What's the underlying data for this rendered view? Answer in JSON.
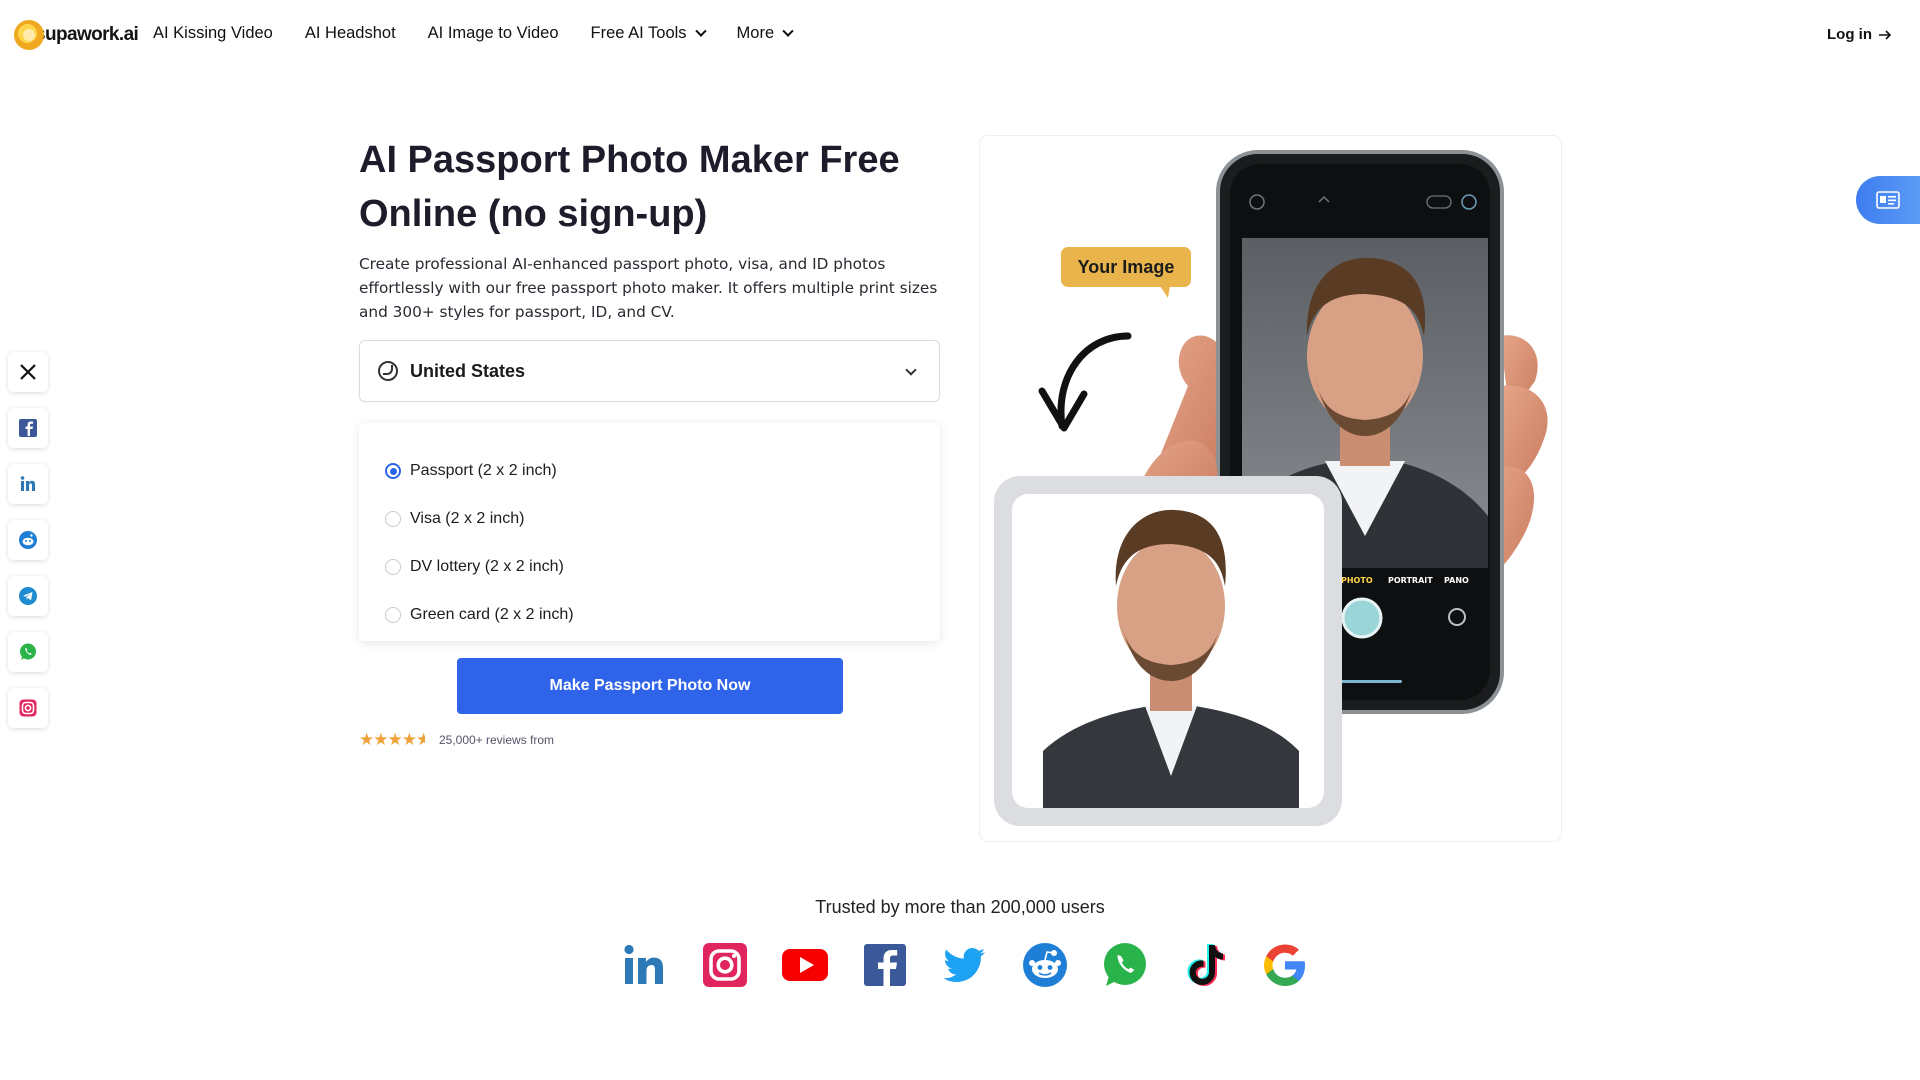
{
  "header": {
    "logo_text": "supawork.ai",
    "nav": [
      {
        "label": "AI Kissing Video",
        "dropdown": false
      },
      {
        "label": "AI Headshot",
        "dropdown": false
      },
      {
        "label": "AI Image to Video",
        "dropdown": false
      },
      {
        "label": "Free AI Tools",
        "dropdown": true
      },
      {
        "label": "More",
        "dropdown": true
      }
    ],
    "login_label": "Log in",
    "login_icon": "arrow-right-icon"
  },
  "hero": {
    "title": "AI Passport Photo Maker Free Online (no sign-up)",
    "description": "Create professional AI-enhanced passport photo, visa, and ID photos effortlessly with our free passport photo maker. It offers multiple print sizes and 300+ styles for passport, ID, and CV.",
    "country": "United States",
    "documents": [
      {
        "label": "Passport (2 x 2 inch)",
        "selected": true
      },
      {
        "label": "Visa (2 x 2 inch)",
        "selected": false
      },
      {
        "label": "DV lottery (2 x 2 inch)",
        "selected": false
      },
      {
        "label": "Green card (2 x 2 inch)",
        "selected": false
      }
    ],
    "cta_label": "Make Passport Photo Now",
    "rating_stars": 4.5,
    "reviews_text": "25,000+ reviews from"
  },
  "image_card": {
    "bubble_text": "Your Image",
    "camera_modes": [
      "PHOTO",
      "PORTRAIT",
      "PANO"
    ]
  },
  "share": [
    "x-icon",
    "facebook-icon",
    "linkedin-icon",
    "reddit-icon",
    "telegram-icon",
    "whatsapp-icon",
    "instagram-icon"
  ],
  "trusted": {
    "text": "Trusted by more than 200,000 users",
    "brands": [
      "linkedin-icon",
      "instagram-icon",
      "youtube-icon",
      "facebook-icon",
      "twitter-icon",
      "reddit-icon",
      "whatsapp-icon",
      "tiktok-icon",
      "google-icon"
    ]
  },
  "colors": {
    "accent": "#2f63ea",
    "star": "#f0a23a",
    "bubble": "#e9b44c"
  }
}
